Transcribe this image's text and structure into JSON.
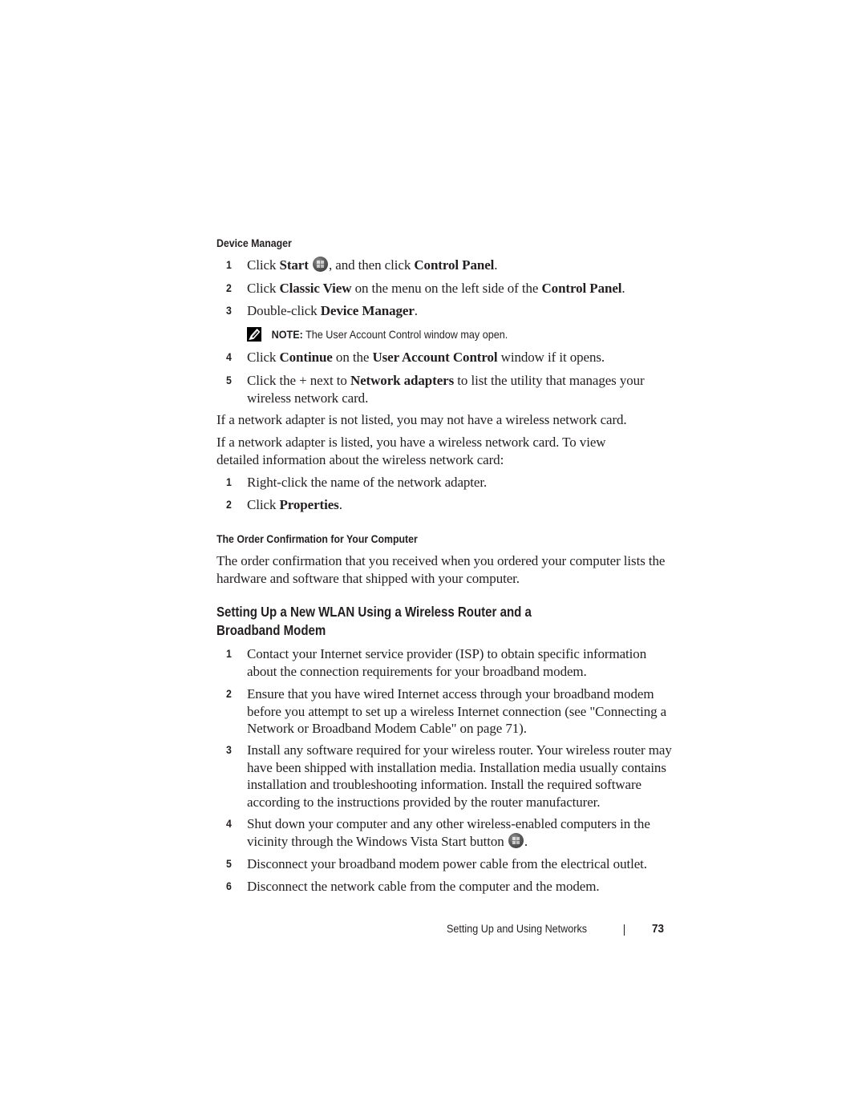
{
  "section1": {
    "heading": "Device Manager",
    "steps": [
      {
        "num": "1",
        "parts": [
          {
            "t": "Click "
          },
          {
            "t": "Start",
            "b": true
          },
          {
            "t": " "
          },
          {
            "icon": "windows-start-icon"
          },
          {
            "t": ", and then click "
          },
          {
            "t": "Control Panel",
            "b": true
          },
          {
            "t": "."
          }
        ]
      },
      {
        "num": "2",
        "parts": [
          {
            "t": "Click "
          },
          {
            "t": "Classic View",
            "b": true
          },
          {
            "t": " on the menu on the left side of the "
          },
          {
            "t": "Control Panel",
            "b": true
          },
          {
            "t": "."
          }
        ]
      },
      {
        "num": "3",
        "parts": [
          {
            "t": "Double-click "
          },
          {
            "t": "Device Manager",
            "b": true
          },
          {
            "t": "."
          }
        ]
      }
    ],
    "note": {
      "label": "NOTE:",
      "text_before": " The ",
      "emph": "User Account Control",
      "text_after": " window may open."
    },
    "steps2": [
      {
        "num": "4",
        "parts": [
          {
            "t": "Click "
          },
          {
            "t": "Continue",
            "b": true
          },
          {
            "t": " on the "
          },
          {
            "t": "User Account Control",
            "b": true
          },
          {
            "t": " window if it opens."
          }
        ]
      },
      {
        "num": "5",
        "parts": [
          {
            "t": "Click the + next to "
          },
          {
            "t": "Network adapters",
            "b": true
          },
          {
            "t": " to list the utility that manages your wireless network card."
          }
        ]
      }
    ],
    "para1": "If a network adapter is not listed, you may not have a wireless network card.",
    "para2": "If a network adapter is listed, you have a wireless network card. To view detailed information about the wireless network card:",
    "steps3": [
      {
        "num": "1",
        "parts": [
          {
            "t": "Right-click the name of the network adapter."
          }
        ]
      },
      {
        "num": "2",
        "parts": [
          {
            "t": "Click "
          },
          {
            "t": "Properties",
            "b": true
          },
          {
            "t": "."
          }
        ]
      }
    ]
  },
  "section2": {
    "heading": "The Order Confirmation for Your Computer",
    "para": "The order confirmation that you received when you ordered your computer lists the hardware and software that shipped with your computer."
  },
  "section3": {
    "heading_line1": "Setting Up a New WLAN Using a Wireless Router and a",
    "heading_line2": "Broadband Modem",
    "steps": [
      {
        "num": "1",
        "parts": [
          {
            "t": "Contact your Internet service provider (ISP) to obtain specific information about the connection requirements for your broadband modem."
          }
        ]
      },
      {
        "num": "2",
        "parts": [
          {
            "t": "Ensure that you have wired Internet access through your broadband modem before you attempt to set up a wireless Internet connection (see \"Connecting a Network or Broadband Modem Cable\" on page 71)."
          }
        ]
      },
      {
        "num": "3",
        "parts": [
          {
            "t": "Install any software required for your wireless router. Your wireless router may have been shipped with installation media. Installation media usually contains installation and troubleshooting information. Install the required software according to the instructions provided by the router manufacturer."
          }
        ]
      },
      {
        "num": "4",
        "parts": [
          {
            "t": "Shut down your computer and any other wireless-enabled computers in the vicinity through the Windows Vista Start button "
          },
          {
            "icon": "windows-start-icon"
          },
          {
            "t": "."
          }
        ]
      },
      {
        "num": "5",
        "parts": [
          {
            "t": "Disconnect your broadband modem power cable from the electrical outlet."
          }
        ]
      },
      {
        "num": "6",
        "parts": [
          {
            "t": "Disconnect the network cable from the computer and the modem."
          }
        ]
      }
    ]
  },
  "footer": {
    "section_title": "Setting Up and Using Networks",
    "page_number": "73"
  }
}
